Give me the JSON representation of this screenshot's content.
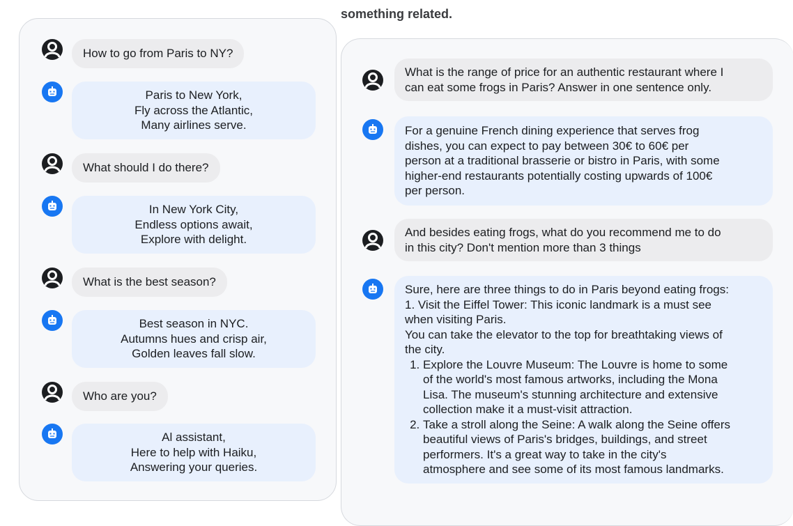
{
  "caption": "something related.",
  "left_chat": {
    "messages": [
      {
        "role": "user",
        "text": "How to go from Paris to NY?"
      },
      {
        "role": "assistant",
        "lines": [
          "Paris to New York,",
          "Fly across the Atlantic,",
          "Many airlines serve."
        ]
      },
      {
        "role": "user",
        "text": "What should I do there?"
      },
      {
        "role": "assistant",
        "lines": [
          "In New York City,",
          "Endless options await,",
          "Explore with delight."
        ]
      },
      {
        "role": "user",
        "text": "What is the best season?"
      },
      {
        "role": "assistant",
        "lines": [
          "Best season in NYC.",
          "Autumns hues and crisp air,",
          "Golden leaves fall slow."
        ]
      },
      {
        "role": "user",
        "text": "Who are you?"
      },
      {
        "role": "assistant",
        "lines": [
          "Al assistant,",
          "Here to help with Haiku,",
          "Answering your queries."
        ]
      }
    ]
  },
  "right_chat": {
    "messages": [
      {
        "role": "user",
        "lines": [
          "What is the range of price for an authentic restaurant where I",
          "can eat some frogs in Paris? Answer in one sentence only."
        ]
      },
      {
        "role": "assistant",
        "lines": [
          "For a genuine French dining experience that serves frog",
          "dishes, you can expect to pay between 30€ to 60€ per",
          "person at a traditional brasserie or bistro in Paris, with some",
          "higher-end restaurants potentially costing upwards of 100€",
          "per person."
        ]
      },
      {
        "role": "user",
        "lines": [
          "And besides eating frogs, what do you recommend me to do",
          "in this city? Don't mention more than 3 things"
        ]
      },
      {
        "role": "assistant",
        "lines": [
          "Sure, here are three things to do in Paris beyond eating frogs:",
          "1. Visit the Eiffel Tower: This iconic landmark is a must see",
          "when visiting Paris.",
          "You can take the elevator to the top for breathtaking views of",
          "the city."
        ],
        "list": [
          [
            "Explore the Louvre Museum: The Louvre is home to some",
            "of the world's most famous artworks, including the Mona",
            "Lisa. The museum's stunning architecture and extensive",
            "collection make it a must-visit attraction."
          ],
          [
            "Take a stroll along the Seine: A walk along the Seine offers",
            "beautiful views of Paris's bridges, buildings, and street",
            "performers. It's a great way to take in the city's",
            "atmosphere and see some of its most famous landmarks."
          ]
        ]
      }
    ]
  },
  "icons": {
    "user": "user-avatar-icon",
    "assistant": "bot-avatar-icon"
  },
  "colors": {
    "assistant_avatar": "#1877f2",
    "assistant_bubble": "#e8f0fd",
    "user_bubble": "#ececee",
    "user_avatar": "#1c1e21"
  }
}
